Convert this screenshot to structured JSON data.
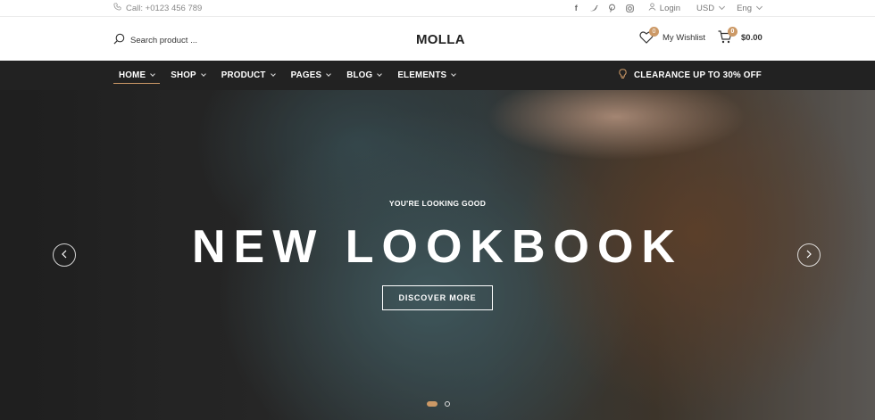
{
  "topbar": {
    "call_text": "Call: +0123 456 789",
    "social": [
      "facebook-icon",
      "twitter-icon",
      "pinterest-icon",
      "instagram-icon"
    ],
    "login_label": "Login",
    "currency": "USD",
    "language": "Eng"
  },
  "header": {
    "search_placeholder": "Search product ...",
    "logo_text": "MOLLA",
    "wishlist_label": "My Wishlist",
    "wishlist_count": "0",
    "cart_count": "0",
    "cart_total": "$0.00"
  },
  "nav": {
    "items": [
      {
        "label": "HOME",
        "active": true
      },
      {
        "label": "SHOP"
      },
      {
        "label": "PRODUCT"
      },
      {
        "label": "PAGES"
      },
      {
        "label": "BLOG"
      },
      {
        "label": "ELEMENTS"
      }
    ],
    "promo": "CLEARANCE UP TO 30% OFF"
  },
  "hero": {
    "kicker": "YOU'RE LOOKING GOOD",
    "title": "NEW LOOKBOOK",
    "cta": "DISCOVER MORE",
    "slide_count": 2,
    "active_slide": 1
  },
  "colors": {
    "accent": "#cc9966",
    "nav_bg": "#222222"
  }
}
